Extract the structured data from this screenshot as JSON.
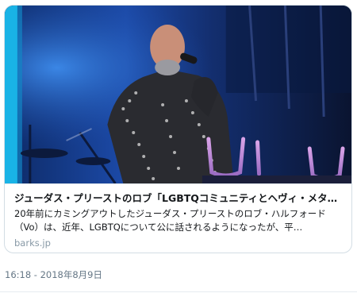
{
  "card": {
    "image": {
      "alt": "Singer in studded leather jacket performing on stage"
    },
    "title": "ジューダス・プリーストのロブ「LGBTQコミュニティとヘヴィ・メタル…",
    "description": "20年前にカミングアウトしたジューダス・プリーストのロブ・ハルフォード（Vo）は、近年、LGBTQについて公に話されるようになったが、平…",
    "domain": "barks.jp"
  },
  "tweet": {
    "timestamp": "16:18 - 2018年8月9日"
  }
}
